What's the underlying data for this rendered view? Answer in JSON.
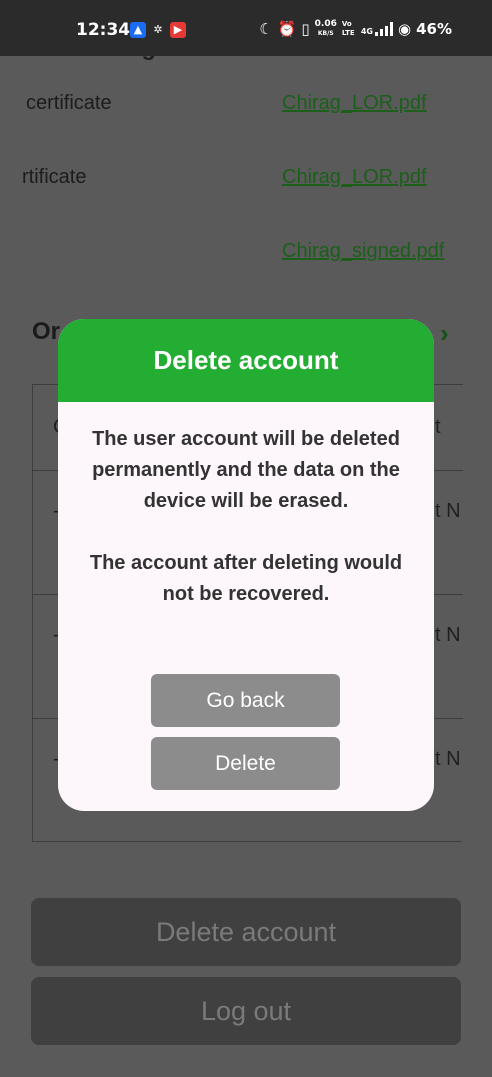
{
  "status_bar": {
    "time": "12:34",
    "speed_value": "0.06",
    "speed_unit": "KB/S",
    "volte": "Vo LTE",
    "network": "4G",
    "battery": "46%"
  },
  "background": {
    "section_title": "Drivers legal details",
    "rows": [
      {
        "label": "certificate",
        "file": "Chirag_LOR.pdf"
      },
      {
        "label": "rtificate",
        "file": "Chirag_LOR.pdf"
      },
      {
        "label": "",
        "file": "Chirag_signed.pdf"
      }
    ],
    "orders_label": "Or",
    "table": {
      "header_left": "C",
      "header_right": "t",
      "cells_left": [
        "-",
        "-",
        "-"
      ],
      "cells_right": [
        "t N",
        "t N",
        "t N"
      ]
    },
    "delete_account_button": "Delete account",
    "logout_button": "Log out"
  },
  "dialog": {
    "title": "Delete account",
    "message_1": "The user account will be deleted permanently and the data on the device will be erased.",
    "message_2": "The account after deleting would not be recovered.",
    "go_back_button": "Go back",
    "delete_button": "Delete"
  },
  "colors": {
    "accent_green": "#23ad33",
    "dialog_bg": "#fdf6fb",
    "dialog_button": "#8c8c8c",
    "scrim": "#5a5a5a"
  }
}
